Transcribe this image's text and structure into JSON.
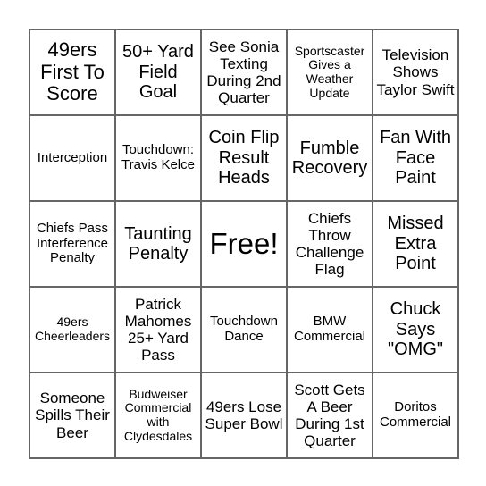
{
  "card": {
    "cells": [
      {
        "text": "49ers First To Score",
        "size": "xl"
      },
      {
        "text": "50+ Yard Field Goal",
        "size": "lg"
      },
      {
        "text": "See Sonia Texting During 2nd Quarter",
        "size": "md"
      },
      {
        "text": "Sportscaster Gives a Weather Update",
        "size": "xs"
      },
      {
        "text": "Television Shows Taylor Swift",
        "size": "md"
      },
      {
        "text": "Interception",
        "size": "sm"
      },
      {
        "text": "Touchdown: Travis Kelce",
        "size": "sm"
      },
      {
        "text": "Coin Flip Result Heads",
        "size": "lg"
      },
      {
        "text": "Fumble Recovery",
        "size": "lg"
      },
      {
        "text": "Fan With Face Paint",
        "size": "lg"
      },
      {
        "text": "Chiefs Pass Interference Penalty",
        "size": "sm"
      },
      {
        "text": "Taunting Penalty",
        "size": "lg"
      },
      {
        "text": "Free!",
        "size": "free"
      },
      {
        "text": "Chiefs Throw Challenge Flag",
        "size": "md"
      },
      {
        "text": "Missed Extra Point",
        "size": "lg"
      },
      {
        "text": "49ers Cheerleaders",
        "size": "xs"
      },
      {
        "text": "Patrick Mahomes 25+ Yard Pass",
        "size": "md"
      },
      {
        "text": "Touchdown Dance",
        "size": "sm"
      },
      {
        "text": "BMW Commercial",
        "size": "sm"
      },
      {
        "text": "Chuck Says \"OMG\"",
        "size": "lg"
      },
      {
        "text": "Someone Spills Their Beer",
        "size": "md"
      },
      {
        "text": "Budweiser Commercial with Clydesdales",
        "size": "xs"
      },
      {
        "text": "49ers Lose Super Bowl",
        "size": "md"
      },
      {
        "text": "Scott Gets A Beer During 1st Quarter",
        "size": "md"
      },
      {
        "text": "Doritos Commercial",
        "size": "sm"
      }
    ]
  }
}
